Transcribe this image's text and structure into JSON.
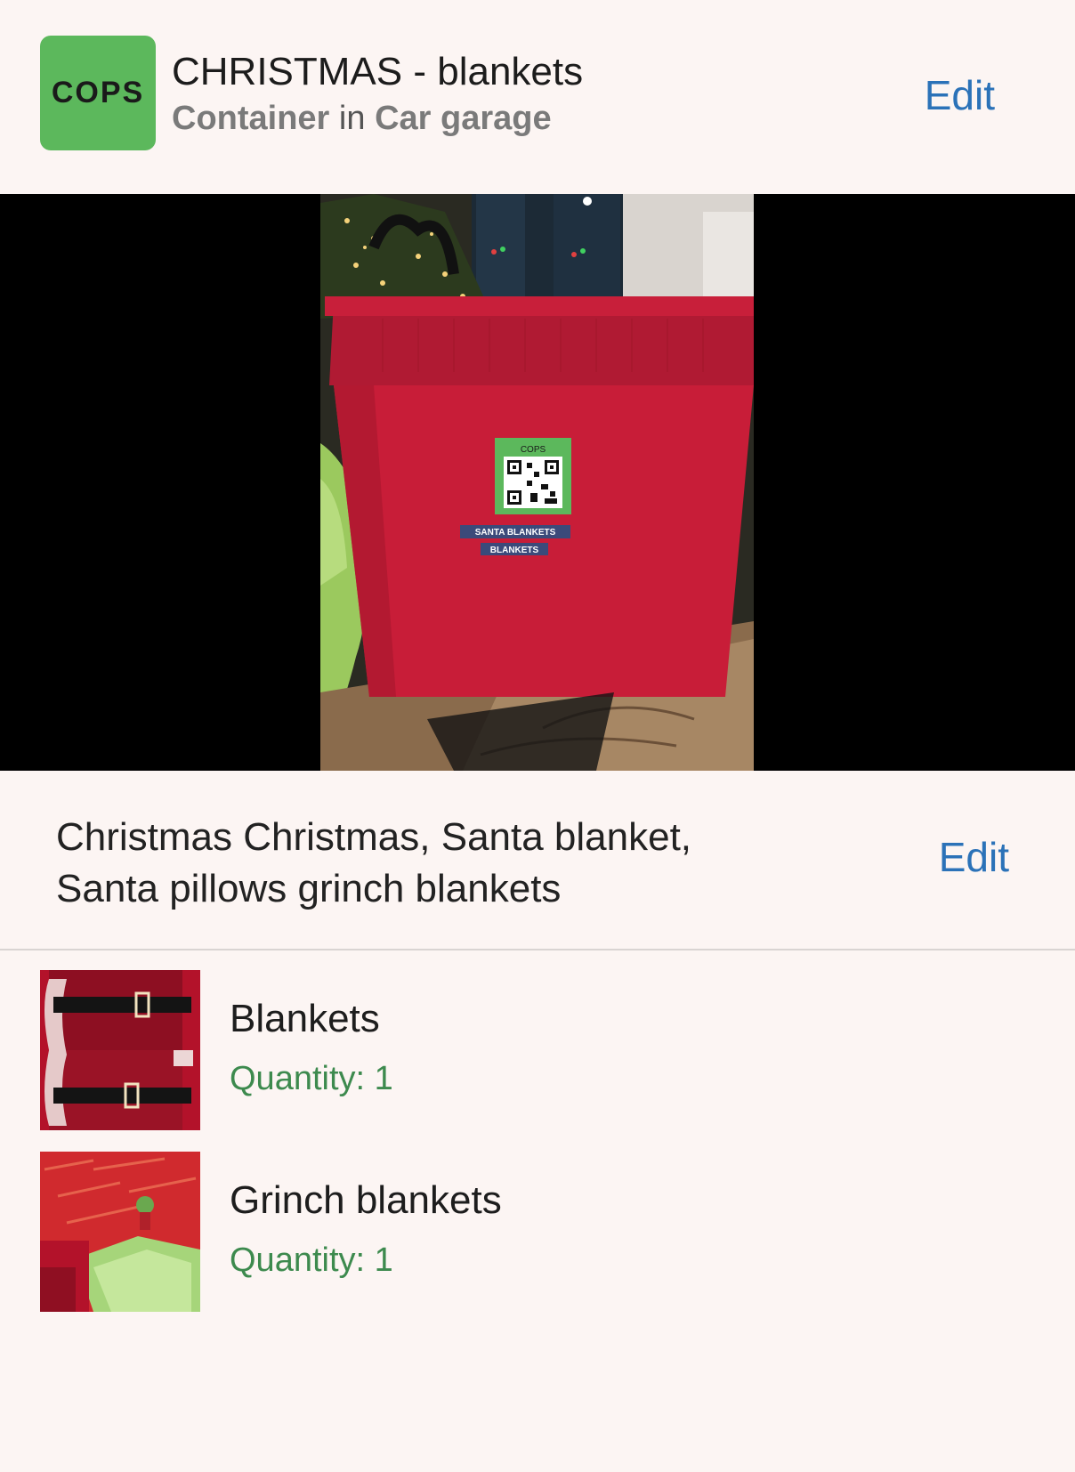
{
  "header": {
    "logo_text": "COPS",
    "title": "CHRISTMAS - blankets",
    "subtitle_type": "Container",
    "subtitle_in": " in ",
    "subtitle_location": "Car garage",
    "edit_label": "Edit"
  },
  "photo": {
    "label_logo": "COPS",
    "label_line1": "SANTA BLANKETS",
    "label_line2": "BLANKETS"
  },
  "description": {
    "text": "Christmas Christmas, Santa blanket, Santa pillows grinch blankets",
    "edit_label": "Edit"
  },
  "items": [
    {
      "name": "Blankets",
      "quantity": "Quantity: 1"
    },
    {
      "name": "Grinch blankets",
      "quantity": "Quantity: 1"
    }
  ],
  "colors": {
    "accent": "#2b72b8",
    "logo_green": "#5cb85c",
    "quantity_green": "#3d8a4e",
    "background": "#fcf5f3"
  }
}
